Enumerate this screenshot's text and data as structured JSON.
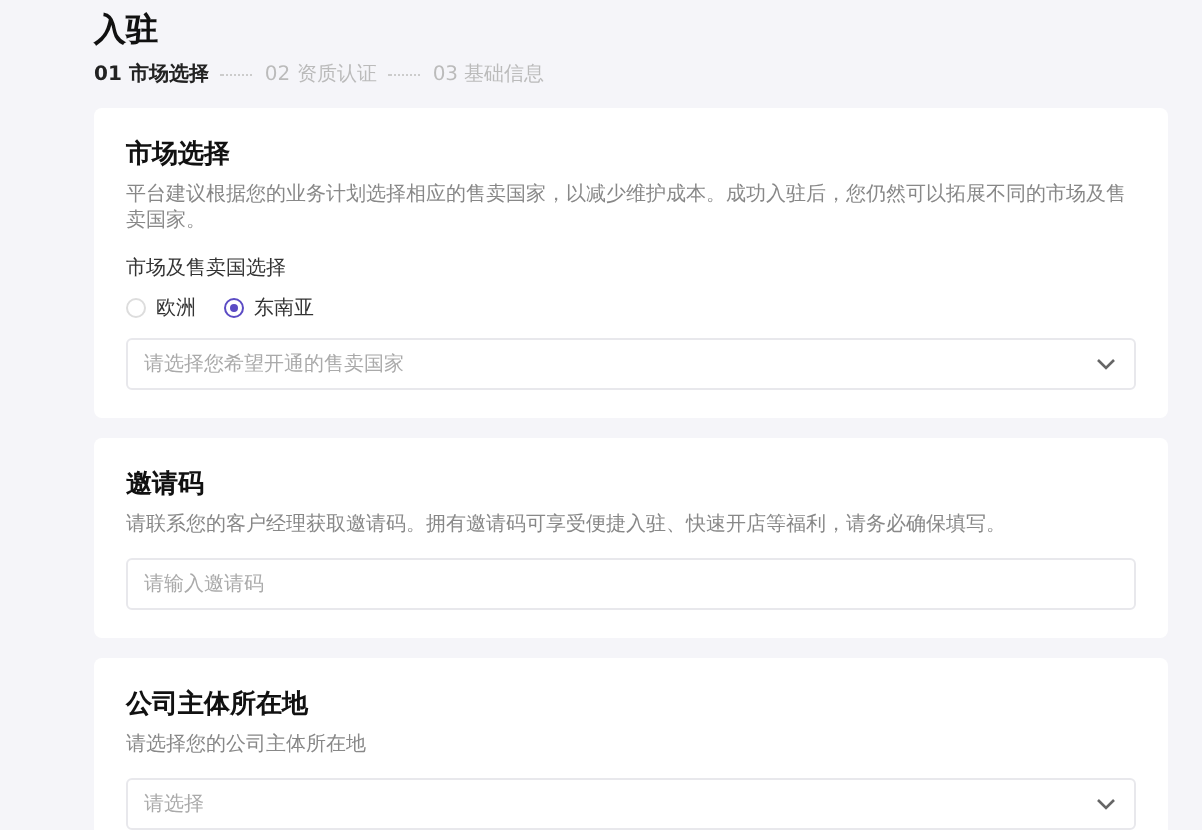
{
  "page": {
    "title": "入驻"
  },
  "steps": [
    {
      "label": "01 市场选择",
      "selected": true
    },
    {
      "label": "02 资质认证",
      "selected": false
    },
    {
      "label": "03 基础信息",
      "selected": false
    }
  ],
  "sections": [
    {
      "title": "市场选择",
      "description": "平台建议根据您的业务计划选择相应的售卖国家，以减少维护成本。成功入驻后，您仍然可以拓展不同的市场及售卖国家。",
      "field_label": "市场及售卖国选择",
      "radios": [
        {
          "label": "欧洲",
          "selected": false
        },
        {
          "label": "东南亚",
          "selected": true
        }
      ],
      "field": {
        "kind": "select",
        "placeholder": "请选择您希望开通的售卖国家"
      }
    },
    {
      "title": "邀请码",
      "description": "请联系您的客户经理获取邀请码。拥有邀请码可享受便捷入驻、快速开店等福利，请务必确保填写。",
      "field": {
        "kind": "input",
        "placeholder": "请输入邀请码"
      }
    },
    {
      "title": "公司主体所在地",
      "description": "请选择您的公司主体所在地",
      "field": {
        "kind": "select",
        "placeholder": "请选择"
      }
    }
  ]
}
